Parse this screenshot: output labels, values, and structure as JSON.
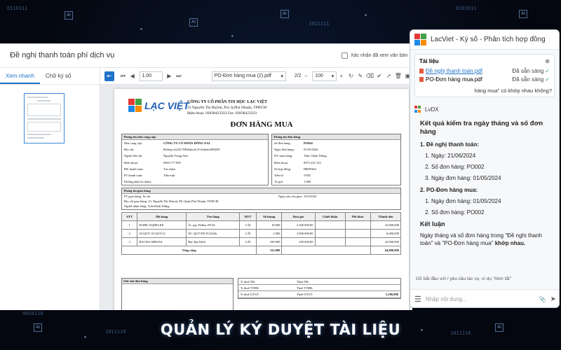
{
  "window": {
    "title": "Đề nghị thanh toán phí dịch vụ",
    "confirm_label": "Xác nhận đã xem văn bản"
  },
  "left_tabs": [
    "Xem nhanh",
    "Chữ ký số"
  ],
  "toolbar": {
    "page_input": "1,00",
    "file_select": "PO-Đơn hàng mua (2).pdf",
    "page_count": "2/2",
    "zoom": "100"
  },
  "document": {
    "logo_text": "LẠC VIỆT",
    "company_name": "CÔNG TY CỔ PHẦN TIN HỌC LẠC VIỆT",
    "company_address": "23 Nguyễn Thị Huỳnh, P.8, Q.Phú Nhuận, TPHCM",
    "company_phone": "Điện thoại:   02838423333         Fax:     02838423333",
    "title": "ĐƠN HÀNG MUA",
    "supplier_header": "Thông tin nhà cung cấp:",
    "supplier_rows": [
      {
        "k": "Nhà cung cấp:",
        "v": "CÔNG TY CỔ PHẦN ĐỒNG NAI"
      },
      {
        "k": "Địa chỉ:",
        "v": "Đường số2,KCNBiênhoà1,P.Anbình,BH,ĐN"
      },
      {
        "k": "Người liên hệ:",
        "v": "Nguyễn Trung Anh"
      },
      {
        "k": "Điện thoại:",
        "v": "0903.777.999"
      },
      {
        "k": "ĐK thanh toán:",
        "v": "Trả chậm"
      },
      {
        "k": "PT thanh toán:",
        "v": "Tiền mặt"
      },
      {
        "k": "Khống phát trả chậm:",
        "v": ""
      }
    ],
    "order_header": "Thông tin đơn hàng",
    "order_rows": [
      {
        "k": "Số đơn hàng:",
        "v": "PO002"
      },
      {
        "k": "Ngày đơn hàng:",
        "v": "01/05/2024"
      },
      {
        "k": "NV mua hàng:",
        "v": "Trần Chiến Thắng"
      },
      {
        "k": "Điện thoại:",
        "v": "0975.221.333"
      },
      {
        "k": "Số hợp đồng:",
        "v": "HĐ09364"
      },
      {
        "k": "Tiền tệ:",
        "v": "VND"
      },
      {
        "k": "Tỷ giá:",
        "v": "1.000"
      }
    ],
    "delivery_header": "Thông tin giao hàng",
    "delivery_method": "PT giao hàng:  Xe tải",
    "delivery_date": "Ngày yêu cầu giao:          15/5/2024",
    "delivery_address": "Địa chỉ giao hàng:  23, Nguyễn Thị Huỳnh, P8, Quận Phú Nhuận, TP.HCM",
    "delivery_receiver": "Người nhận hàng:  Trần Đình Thắng",
    "table_headers": [
      "STT",
      "Mã hàng",
      "Tên hàng",
      "ĐVT",
      "Số lượng",
      "Đơn giá",
      "Chiết khấu",
      "Phí khác",
      "Thành tiền"
    ],
    "table_rows": [
      [
        "1",
        "DODE-AQDELKE",
        "Ắc quy Delkor NT24",
        "CÁI",
        "10.000",
        "3.300.000.00",
        "",
        "",
        "33,000,000"
      ],
      [
        "2",
        "ACQUY-ACQUY12",
        "ẮC QUY ĐN N120Ah",
        "CÁI",
        "2.000",
        "3.000.000.00",
        "",
        "",
        "6,000,000"
      ],
      [
        "3",
        "BACDA-0006254",
        "Bạc đạn 6204",
        "CÁI",
        "100.000",
        "250.000.00",
        "",
        "",
        "25,000,000"
      ]
    ],
    "total_label": "Tổng cộng",
    "total_qty": "112.000",
    "total_amount": "64,000,000",
    "notes_header": "Ghi chú đơn hàng",
    "tax_rows": [
      {
        "k1": "% thuế NK:",
        "k2": "Thuế NK:",
        "v": ""
      },
      {
        "k1": "% thuế TTĐB:",
        "k2": "Thuế TTĐB:",
        "v": ""
      },
      {
        "k1": "% thuế GTGT:",
        "k2": "Thuế GTGT:",
        "v": "5,200,000"
      }
    ]
  },
  "ai_panel": {
    "title": "LacViet - Ký số - Phân tích hợp đồng",
    "files_label": "Tài liệu",
    "files": [
      {
        "name": "Đề nghị thanh toán.pdf",
        "status": "Đã sẵn sàng"
      },
      {
        "name": "PO-Đơn hàng mua.pdf",
        "status": "Đã sẵn sàng"
      }
    ],
    "question_tail": "hàng mua\" có khớp nhau không?",
    "author": "LvDX",
    "answer_title": "Kết quả kiểm tra ngày tháng và số đơn hàng",
    "section1_title": "1. Đề nghị thanh toán:",
    "section1_items": [
      "Ngày: 21/06/2024",
      "Số đơn hàng: PO002",
      "Ngày đơn hàng: 01/05/2024"
    ],
    "section2_title": "2. PO-Đơn hàng mua:",
    "section2_items": [
      "Ngày đơn hàng: 01/05/2024",
      "Số đơn hàng: PO002"
    ],
    "conclusion_title": "Kết luận",
    "conclusion_text": "Ngày tháng và số đơn hàng trong \"Đề nghị thanh toán\" và \"PO-Đơn hàng mua\" ",
    "conclusion_bold": "khớp nhau.",
    "hint": "Gõ bắt đầu với / yêu cầu tác vụ, ví dụ \"/tóm tắt\"",
    "input_placeholder": "Nhập nội dung..."
  },
  "caption": "QUẢN LÝ KÝ DUYỆT TÀI LIỆU",
  "colors": {
    "accent": "#1e73c9",
    "logo_red": "#e53935",
    "logo_green": "#43a047",
    "logo_blue": "#1e88e5",
    "logo_orange": "#fb8c00"
  }
}
